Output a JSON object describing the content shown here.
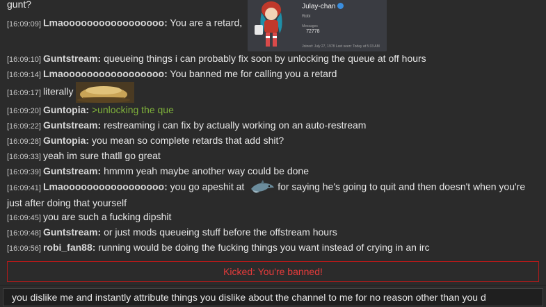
{
  "top_fragment": "gunt?",
  "messages": [
    {
      "ts": "[16:09:09]",
      "nick": "Lmaooooooooooooooooo:",
      "text": "You are a retard,",
      "embed": true
    },
    {
      "ts": "[16:09:10]",
      "nick": "Guntstream:",
      "text": "queueing things i can probably fix soon by unlocking the queue at off hours"
    },
    {
      "ts": "[16:09:14]",
      "nick": "Lmaooooooooooooooooo:",
      "text": "You banned me for calling you a retard"
    },
    {
      "ts": "[16:09:17]",
      "nick": "",
      "text": "literally",
      "emote": "literally"
    },
    {
      "ts": "[16:09:20]",
      "nick": "Guntopia:",
      "text": ">unlocking the que",
      "green": true
    },
    {
      "ts": "[16:09:22]",
      "nick": "Guntstream:",
      "text": "restreaming i can fix by actually working on an auto-restream"
    },
    {
      "ts": "[16:09:28]",
      "nick": "Guntopia:",
      "text": "you mean so complete retards that add shit?"
    },
    {
      "ts": "[16:09:33]",
      "nick": "",
      "text": "yeah im sure thatll go great"
    },
    {
      "ts": "[16:09:39]",
      "nick": "Guntstream:",
      "text": "hmmm yeah maybe another way could be done"
    },
    {
      "ts": "[16:09:41]",
      "nick": "Lmaooooooooooooooooo:",
      "text": "you go apeshit at",
      "emote": "dolphin",
      "text_after": "for saying he's going to quit and then doesn't when you're just after doing that yourself"
    },
    {
      "ts": "[16:09:45]",
      "nick": "",
      "text": "you are such a fucking dipshit"
    },
    {
      "ts": "[16:09:48]",
      "nick": "Guntstream:",
      "text": "or just mods queueing stuff before the offstream hours"
    },
    {
      "ts": "[16:09:56]",
      "nick": "robi_fan88:",
      "text": "running would be doing the fucking things you want instead of crying in an irc"
    }
  ],
  "embed_card": {
    "name": "Julay-chan",
    "sub": "Robi",
    "label": "Messages",
    "value": "72778",
    "joined": "Joined: July 27, 1978   Last seen: Today at 5:33 AM"
  },
  "kick_banner": "Kicked: You're banned!",
  "input": {
    "value": "you dislike me and instantly attribute things you dislike about the channel to me for no reason other than you d"
  },
  "colors": {
    "background": "#2b2b2b",
    "greentext": "#7fb13b",
    "kick_red": "#e63b3b",
    "kick_border": "#b11a1a"
  }
}
